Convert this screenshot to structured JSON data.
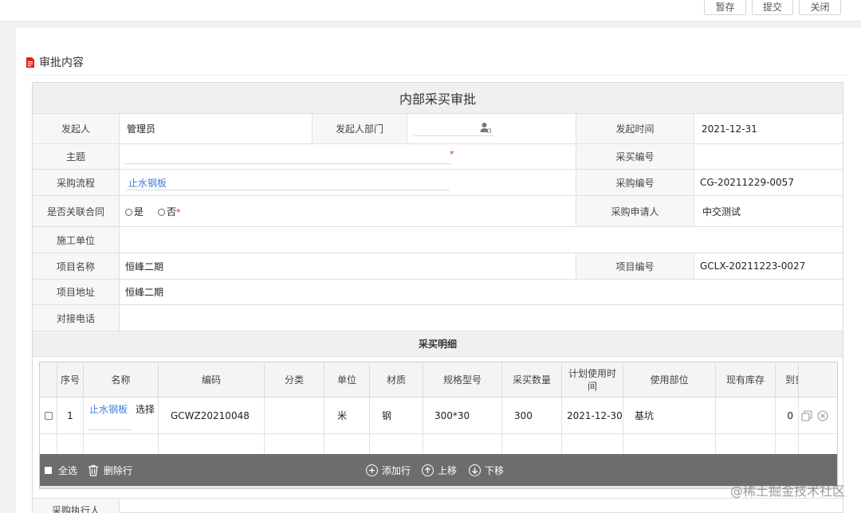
{
  "toolbar": {
    "save_draft": "暂存",
    "submit": "提交",
    "close": "关闭"
  },
  "section": {
    "title": "审批内容",
    "icon": "document-icon"
  },
  "form": {
    "title": "内部采买审批",
    "initiator_label": "发起人",
    "initiator_value": "管理员",
    "initiator_dept_label": "发起人部门",
    "initiator_dept_value": "",
    "initiate_time_label": "发起时间",
    "initiate_time_value": "2021-12-31",
    "subject_label": "主题",
    "subject_value": "",
    "required_mark": "*",
    "purchase_no_label": "采买编号",
    "purchase_no_value": "",
    "procurement_flow_label": "采购流程",
    "procurement_flow_value": "止水钢板",
    "procurement_no_label": "采购编号",
    "procurement_no_value": "CG-20211229-0057",
    "linked_contract_label": "是否关联合同",
    "linked_contract_yes": "是",
    "linked_contract_no": "否",
    "applicant_label": "采购申请人",
    "applicant_value": "中交测试",
    "construction_unit_label": "施工单位",
    "construction_unit_value": "",
    "project_name_label": "项目名称",
    "project_name_value": "恒峰二期",
    "project_no_label": "项目编号",
    "project_no_value": "GCLX-20211223-0027",
    "project_address_label": "项目地址",
    "project_address_value": "恒峰二期",
    "contact_phone_label": "对接电话",
    "contact_phone_value": "",
    "detail_title": "采买明细",
    "executor_label": "采购执行人"
  },
  "detail_table": {
    "columns": [
      "序号",
      "名称",
      "编码",
      "分类",
      "单位",
      "材质",
      "规格型号",
      "采买数量",
      "计划使用时间",
      "使用部位",
      "现有库存",
      "到货"
    ],
    "column_planned_time_line1": "计划使用时",
    "column_planned_time_line2": "间",
    "column_arrival_partial": "到贫",
    "rows": [
      {
        "seq": "1",
        "name": "止水钢板",
        "select_label": "选择",
        "code": "GCWZ20210048",
        "category": "",
        "unit": "米",
        "material": "钢",
        "spec": "300*30",
        "quantity": "300",
        "planned_time": "2021-12-30",
        "location": "基坑",
        "stock": "",
        "arrival": "0"
      }
    ],
    "footer": {
      "select_all": "全选",
      "delete_row": "删除行",
      "add_row": "添加行",
      "move_up": "上移",
      "move_down": "下移"
    }
  },
  "watermark": "@稀土掘金技术社区",
  "colors": {
    "link": "#3b7dd8",
    "required": "#e02020",
    "footer_bg": "#6d6d6d",
    "doc_icon": "#e02020"
  }
}
